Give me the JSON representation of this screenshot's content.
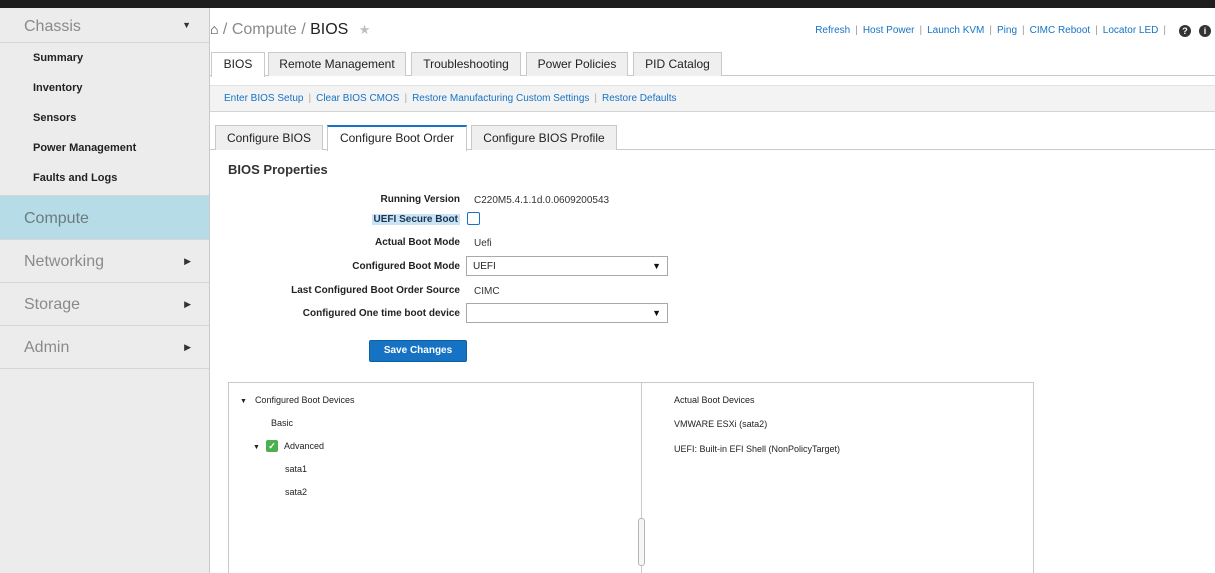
{
  "sidebar": {
    "chassis": {
      "label": "Chassis",
      "items": [
        {
          "label": "Summary"
        },
        {
          "label": "Inventory"
        },
        {
          "label": "Sensors"
        },
        {
          "label": "Power Management"
        },
        {
          "label": "Faults and Logs"
        }
      ]
    },
    "compute": {
      "label": "Compute"
    },
    "networking": {
      "label": "Networking"
    },
    "storage": {
      "label": "Storage"
    },
    "admin": {
      "label": "Admin"
    }
  },
  "breadcrumb": {
    "sep1": "/",
    "compute": "Compute",
    "sep2": "/",
    "current": "BIOS"
  },
  "header_actions": [
    {
      "label": "Refresh"
    },
    {
      "label": "Host Power"
    },
    {
      "label": "Launch KVM"
    },
    {
      "label": "Ping"
    },
    {
      "label": "CIMC Reboot"
    },
    {
      "label": "Locator LED"
    }
  ],
  "separator": "|",
  "icons": {
    "home": "home-icon",
    "star": "star-icon",
    "help": "help-icon",
    "info": "info-icon",
    "dropdown": "chevron-down-icon",
    "tree_expand": "triangle-down-icon",
    "check": "checkbox-checked-icon"
  },
  "main_tabs": [
    {
      "label": "BIOS",
      "active": true
    },
    {
      "label": "Remote Management",
      "active": false
    },
    {
      "label": "Troubleshooting",
      "active": false
    },
    {
      "label": "Power Policies",
      "active": false
    },
    {
      "label": "PID Catalog",
      "active": false
    }
  ],
  "bios_actions": [
    {
      "label": "Enter BIOS Setup"
    },
    {
      "label": "Clear BIOS CMOS"
    },
    {
      "label": "Restore Manufacturing Custom Settings"
    },
    {
      "label": "Restore Defaults"
    }
  ],
  "sub_tabs": [
    {
      "label": "Configure BIOS",
      "active": false
    },
    {
      "label": "Configure Boot Order",
      "active": true
    },
    {
      "label": "Configure BIOS Profile",
      "active": false
    }
  ],
  "section_title": "BIOS Properties",
  "properties": {
    "running_version": {
      "label": "Running Version",
      "value": "C220M5.4.1.1d.0.0609200543"
    },
    "uefi_secure_boot": {
      "label": "UEFI Secure Boot",
      "checked": false
    },
    "actual_boot_mode": {
      "label": "Actual Boot Mode",
      "value": "Uefi"
    },
    "configured_boot_mode": {
      "label": "Configured Boot Mode",
      "value": "UEFI"
    },
    "last_boot_order_source": {
      "label": "Last Configured Boot Order Source",
      "value": "CIMC"
    },
    "one_time_boot_device": {
      "label": "Configured One time boot device",
      "value": ""
    }
  },
  "save_button": "Save Changes",
  "configured_boot_devices": {
    "title": "Configured Boot Devices",
    "basic": "Basic",
    "advanced": {
      "label": "Advanced",
      "checked": true,
      "children": [
        "sata1",
        "sata2"
      ]
    }
  },
  "actual_boot_devices": {
    "title": "Actual Boot Devices",
    "items": [
      "VMWARE ESXi (sata2)",
      "UEFI: Built-in EFI Shell (NonPolicyTarget)"
    ]
  },
  "colors": {
    "accent": "#1673c4",
    "sidebar_active": "#b6dde7",
    "check_green": "#4caf50"
  }
}
